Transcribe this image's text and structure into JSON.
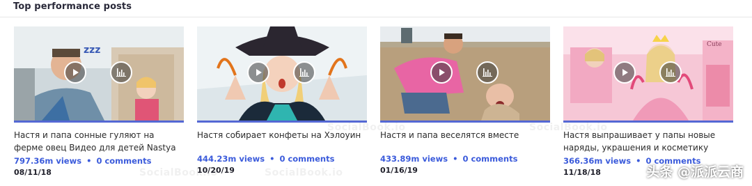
{
  "section_title": "Top performance posts",
  "watermark_text": "SocialBook.io",
  "overlay_watermark": "头条 @派派云商",
  "accent_color": "#5468d4",
  "link_color": "#3b5bdb",
  "posts": [
    {
      "title": "Настя и папа сонные гуляют на ферме овец Видео для детей Nastya and pap...",
      "views": "797.36m views",
      "comments": "0 comments",
      "date": "08/11/18"
    },
    {
      "title": "Настя собирает конфеты на Хэлоуин",
      "views": "444.23m views",
      "comments": "0 comments",
      "date": "10/20/19"
    },
    {
      "title": "Настя и папа веселятся вместе",
      "views": "433.89m views",
      "comments": "0 comments",
      "date": "01/16/19"
    },
    {
      "title": "Настя выпрашивает у папы новые наряды, украшения и косметику",
      "views": "366.36m views",
      "comments": "0 comments",
      "date": "11/18/18"
    }
  ]
}
